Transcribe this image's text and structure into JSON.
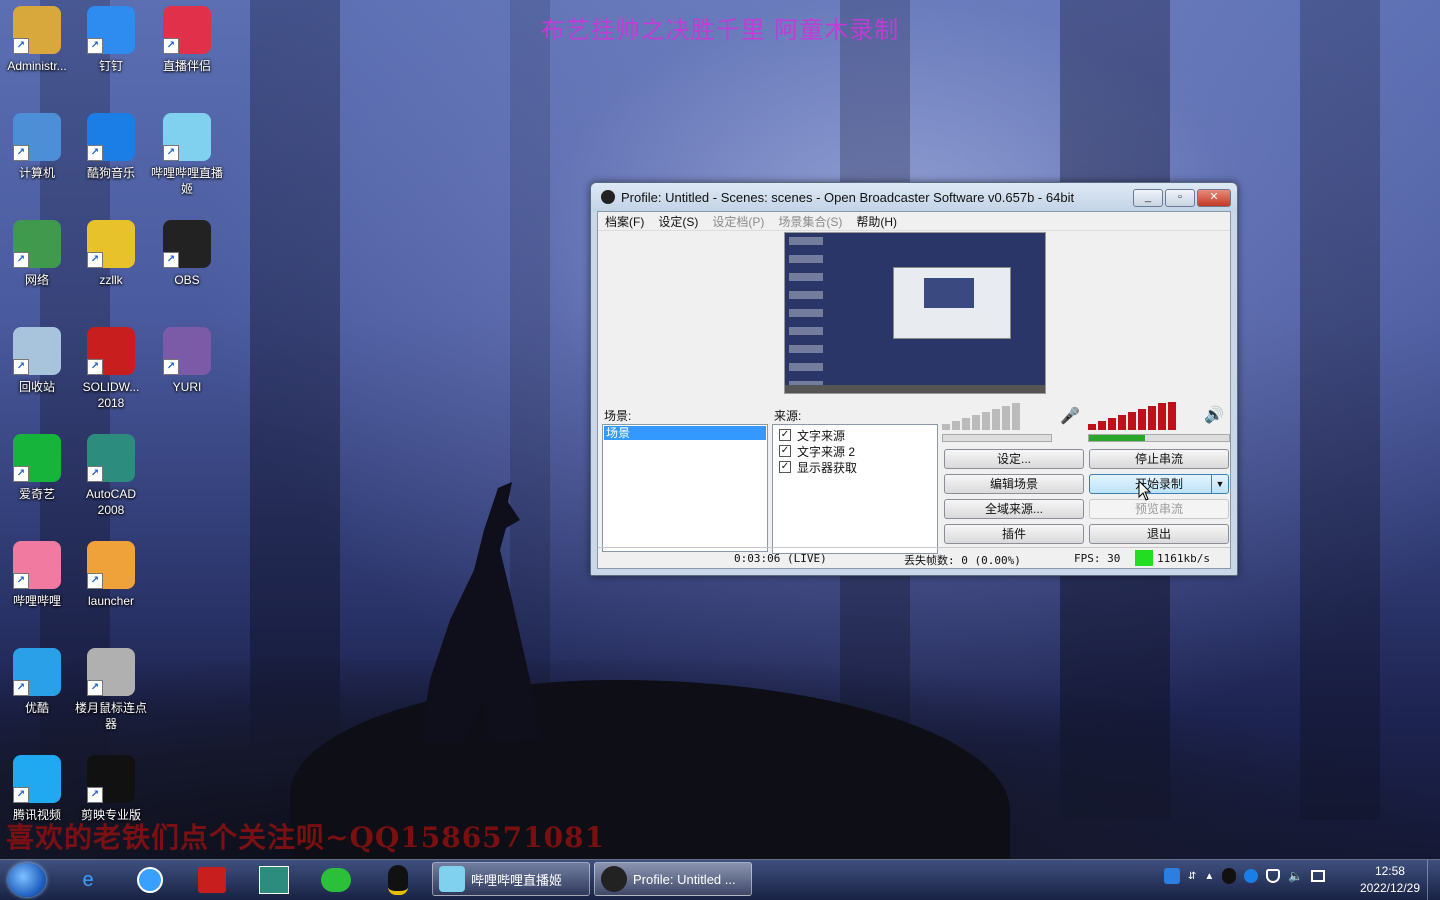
{
  "overlay": {
    "top_banner": "布艺挂帅之决胜千里 阿童木录制",
    "bottom_banner": "喜欢的老铁们点个关注呗~QQ1586571081"
  },
  "desktop_icons": [
    {
      "label": "Administr...",
      "icon": "user-folder-icon",
      "color": "#d8a83c"
    },
    {
      "label": "钉钉",
      "icon": "dingtalk-icon",
      "color": "#2e8bf0"
    },
    {
      "label": "直播伴侣",
      "icon": "live-companion-icon",
      "color": "#e0304a"
    },
    {
      "label": "计算机",
      "icon": "computer-icon",
      "color": "#4d8fd6"
    },
    {
      "label": "酷狗音乐",
      "icon": "kugou-icon",
      "color": "#1a7ee6"
    },
    {
      "label": "哔哩哔哩直播姬",
      "icon": "bilibili-live-icon",
      "color": "#7fd1ef"
    },
    {
      "label": "网络",
      "icon": "network-icon",
      "color": "#3f9a4e"
    },
    {
      "label": "zzllk",
      "icon": "zzllk-icon",
      "color": "#e8c22a"
    },
    {
      "label": "OBS",
      "icon": "obs-icon",
      "color": "#222222"
    },
    {
      "label": "回收站",
      "icon": "recycle-bin-icon",
      "color": "#a7c4dc"
    },
    {
      "label": "SOLIDW... 2018",
      "icon": "solidworks-icon",
      "color": "#c81e1e"
    },
    {
      "label": "YURI",
      "icon": "yuri-icon",
      "color": "#7b5aa8"
    },
    {
      "label": "爱奇艺",
      "icon": "iqiyi-icon",
      "color": "#17b43c"
    },
    {
      "label": "AutoCAD 2008",
      "icon": "autocad-icon",
      "color": "#2c8c7e"
    },
    {
      "label": "哔哩哔哩",
      "icon": "bilibili-icon",
      "color": "#f07aa0"
    },
    {
      "label": "launcher",
      "icon": "launcher-icon",
      "color": "#f0a23a"
    },
    {
      "label": "优酷",
      "icon": "youku-icon",
      "color": "#2aa0e8"
    },
    {
      "label": "楼月鼠标连点器",
      "icon": "mouse-clicker-icon",
      "color": "#b0b0b0"
    },
    {
      "label": "腾讯视频",
      "icon": "tencent-video-icon",
      "color": "#20a8f0"
    },
    {
      "label": "剪映专业版",
      "icon": "capcut-icon",
      "color": "#111111"
    }
  ],
  "obs": {
    "title": "Profile: Untitled - Scenes: scenes - Open Broadcaster Software v0.657b - 64bit",
    "menu": [
      "档案(F)",
      "设定(S)",
      "设定档(P)",
      "场景集合(S)",
      "帮助(H)"
    ],
    "scenes_label": "场景:",
    "sources_label": "来源:",
    "scenes": [
      "场景"
    ],
    "sources": [
      "文字来源",
      "文字来源 2",
      "显示器获取"
    ],
    "buttons": {
      "settings": "设定...",
      "stop_stream": "停止串流",
      "edit_scene": "编辑场景",
      "start_record": "开始录制",
      "global_sources": "全域来源...",
      "preview_stream": "预览串流",
      "plugins": "插件",
      "exit": "退出"
    },
    "status": {
      "time": "0:03:06 (LIVE)",
      "dropped": "丢失帧数: 0 (0.00%)",
      "fps": "FPS: 30",
      "bitrate": "1161kb/s"
    }
  },
  "taskbar": {
    "pinned": [
      "ie-icon",
      "search-icon",
      "solidworks-icon",
      "autocad-icon",
      "wechat-icon",
      "qq-icon"
    ],
    "tasks": [
      "哔哩哔哩直播姬",
      "Profile: Untitled ..."
    ],
    "clock_time": "12:58",
    "clock_date": "2022/12/29"
  }
}
